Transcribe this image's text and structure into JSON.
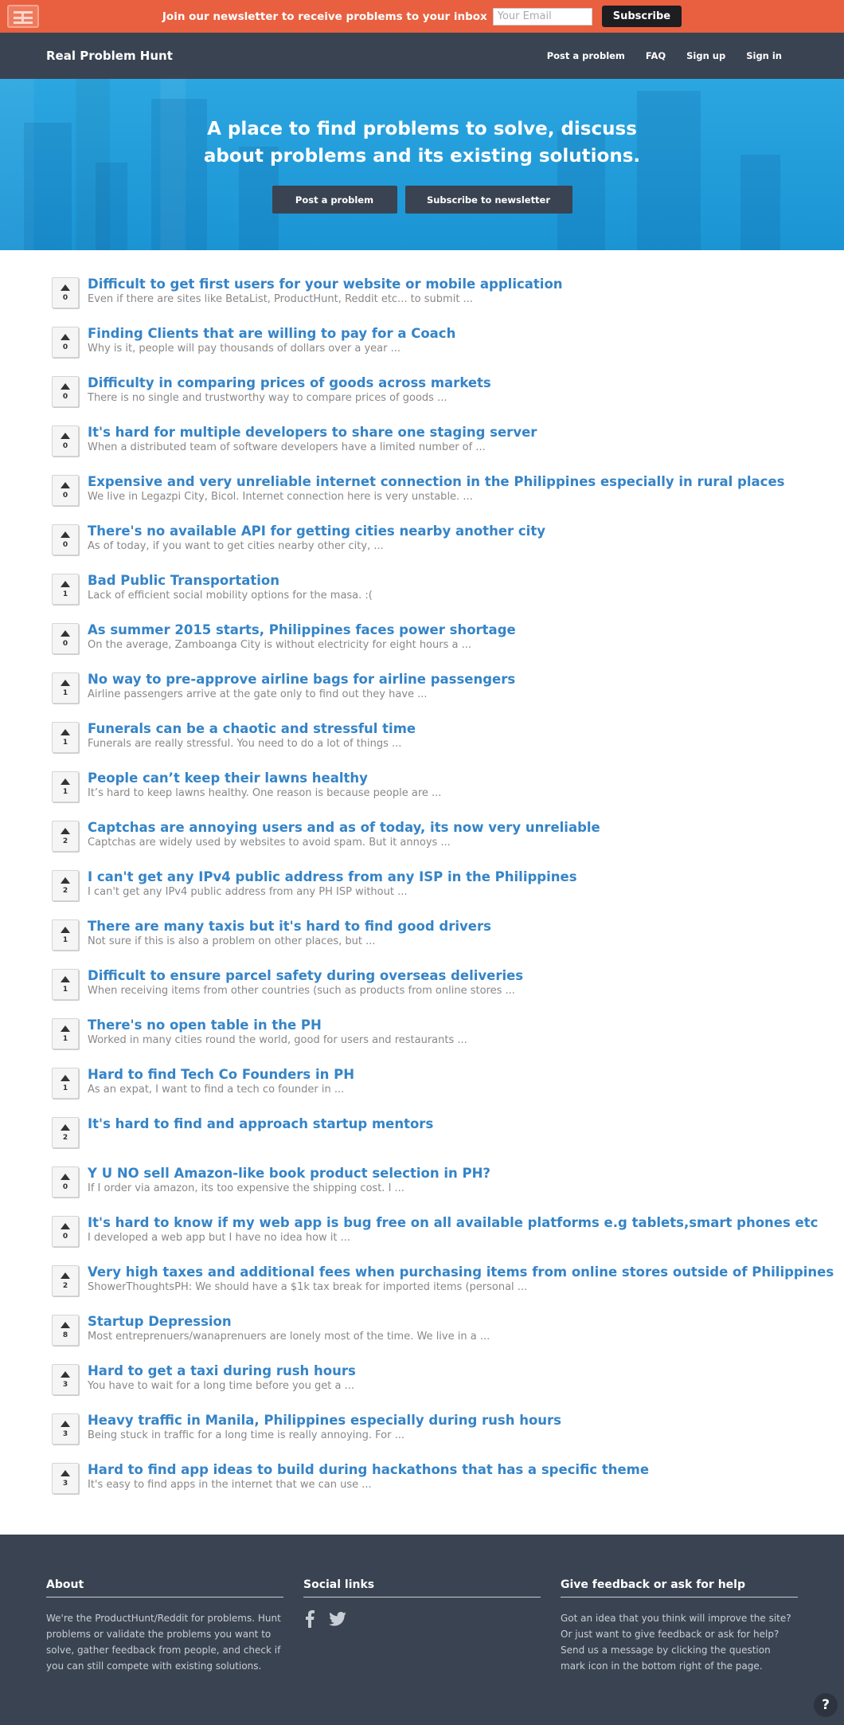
{
  "newsletter_bar": {
    "message": "Join our newsletter to receive problems to your inbox",
    "email_placeholder": "Your Email",
    "subscribe_label": "Subscribe",
    "logo_icon": "logo-icon"
  },
  "nav": {
    "brand": "Real Problem Hunt",
    "links": [
      "Post a problem",
      "FAQ",
      "Sign up",
      "Sign in"
    ]
  },
  "hero": {
    "headline_line1": "A place to find problems to solve, discuss",
    "headline_line2": "about problems and its existing solutions.",
    "post_button": "Post a problem",
    "subscribe_button": "Subscribe to newsletter"
  },
  "problems": [
    {
      "votes": "0",
      "title": "Difficult to get first users for your website or mobile application",
      "excerpt": "Even if there are sites like BetaList, ProductHunt, Reddit etc... to submit ..."
    },
    {
      "votes": "0",
      "title": "Finding Clients that are willing to pay for a Coach",
      "excerpt": "Why is it, people will pay thousands of dollars over a year ..."
    },
    {
      "votes": "0",
      "title": "Difficulty in comparing prices of goods across markets",
      "excerpt": "There is no single and trustworthy way to compare prices of goods ..."
    },
    {
      "votes": "0",
      "title": "It's hard for multiple developers to share one staging server",
      "excerpt": "When a distributed team of software developers have a limited number of ..."
    },
    {
      "votes": "0",
      "title": "Expensive and very unreliable internet connection in the Philippines especially in rural places",
      "excerpt": "We live in Legazpi City, Bicol. Internet connection here is very unstable. ..."
    },
    {
      "votes": "0",
      "title": "There's no available API for getting cities nearby another city",
      "excerpt": "As of today, if you want to get cities nearby other city, ..."
    },
    {
      "votes": "1",
      "title": "Bad Public Transportation",
      "excerpt": "Lack of efficient social mobility options for the masa. :("
    },
    {
      "votes": "0",
      "title": "As summer 2015 starts, Philippines faces power shortage",
      "excerpt": "On the average, Zamboanga City is without electricity for eight hours a ..."
    },
    {
      "votes": "1",
      "title": "No way to pre-approve airline bags for airline passengers",
      "excerpt": "Airline passengers arrive at the gate only to find out they have ..."
    },
    {
      "votes": "1",
      "title": "Funerals can be a chaotic and stressful time",
      "excerpt": "Funerals are really stressful. You need to do a lot of things ..."
    },
    {
      "votes": "1",
      "title": "People can’t keep their lawns healthy",
      "excerpt": "It’s hard to keep lawns healthy. One reason is because people are ..."
    },
    {
      "votes": "2",
      "title": "Captchas are annoying users and as of today, its now very unreliable",
      "excerpt": "Captchas are widely used by websites to avoid spam. But it annoys ..."
    },
    {
      "votes": "2",
      "title": "I can't get any IPv4 public address from any ISP in the Philippines",
      "excerpt": "I can't get any IPv4 public address from any PH ISP without ..."
    },
    {
      "votes": "1",
      "title": "There are many taxis but it's hard to find good drivers",
      "excerpt": "Not sure if this is also a problem on other places, but ..."
    },
    {
      "votes": "1",
      "title": "Difficult to ensure parcel safety during overseas deliveries",
      "excerpt": "When receiving items from other countries (such as products from online stores ..."
    },
    {
      "votes": "1",
      "title": "There's no open table in the PH",
      "excerpt": "Worked in many cities round the world, good for users and restaurants ..."
    },
    {
      "votes": "1",
      "title": "Hard to find Tech Co Founders in PH",
      "excerpt": "As an expat, I want to find a tech co founder in ..."
    },
    {
      "votes": "2",
      "title": "It's hard to find and approach startup mentors",
      "excerpt": ""
    },
    {
      "votes": "0",
      "title": "Y U NO sell Amazon-like book product selection in PH?",
      "excerpt": "If I order via amazon, its too expensive the shipping cost. I ..."
    },
    {
      "votes": "0",
      "title": "It's hard to know if my web app is bug free on all available platforms e.g tablets,smart phones etc",
      "excerpt": "I developed a web app but I have no idea how it ..."
    },
    {
      "votes": "2",
      "title": "Very high taxes and additional fees when purchasing items from online stores outside of Philippines",
      "excerpt": "ShowerThoughtsPH: We should have a $1k tax break for imported items (personal ..."
    },
    {
      "votes": "8",
      "title": "Startup Depression",
      "excerpt": "Most entreprenuers/wanaprenuers are lonely most of the time. We live in a ..."
    },
    {
      "votes": "3",
      "title": "Hard to get a taxi during rush hours",
      "excerpt": "You have to wait for a long time before you get a ..."
    },
    {
      "votes": "3",
      "title": "Heavy traffic in Manila, Philippines especially during rush hours",
      "excerpt": "Being stuck in traffic for a long time is really annoying. For ..."
    },
    {
      "votes": "3",
      "title": "Hard to find app ideas to build during hackathons that has a specific theme",
      "excerpt": "It's easy to find apps in the internet that we can use ..."
    }
  ],
  "footer": {
    "about": {
      "heading": "About",
      "text": "We're the ProductHunt/Reddit for problems. Hunt problems or validate the problems you want to solve, gather feedback from people, and check if you can still compete with existing solutions."
    },
    "social": {
      "heading": "Social links",
      "icons": [
        "facebook-icon",
        "twitter-icon"
      ]
    },
    "feedback": {
      "heading": "Give feedback or ask for help",
      "text": "Got an idea that you think will improve the site? Or just want to give feedback or ask for help? Send us a message by clicking the question mark icon in the bottom right of the page."
    },
    "help_label": "?"
  },
  "colors": {
    "newsletter_bar": "#e8603f",
    "navbar": "#3a4351",
    "hero": "#1f9ad8",
    "title_link": "#3584c7",
    "footer": "#3a4351"
  }
}
